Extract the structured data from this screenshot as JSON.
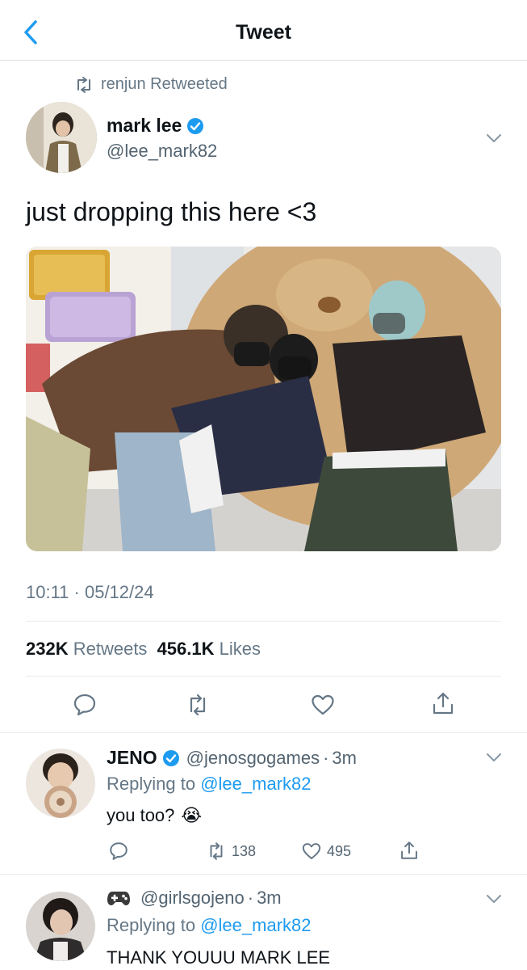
{
  "header": {
    "title": "Tweet"
  },
  "retweet_context": {
    "text": "renjun Retweeted"
  },
  "tweet": {
    "author_name": "mark lee",
    "author_handle": "@lee_mark82",
    "text": "just dropping this here <3",
    "timestamp": "10:11 · 05/12/24",
    "retweets_count": "232K",
    "retweets_label": "Retweets",
    "likes_count": "456.1K",
    "likes_label": "Likes"
  },
  "replies": [
    {
      "name": "JENO",
      "handle": "@jenosgogames",
      "time": "3m",
      "replying_prefix": "Replying to",
      "replying_to": "@lee_mark82",
      "text": "you too?",
      "emoji": "😭",
      "retweets": "138",
      "likes": "495"
    },
    {
      "name_icon": "game-controller-icon",
      "handle": "@girlsgojeno",
      "time": "3m",
      "replying_prefix": "Replying to",
      "replying_to": "@lee_mark82",
      "text": "THANK YOUUU MARK LEE"
    }
  ],
  "colors": {
    "accent": "#1d9bf0",
    "muted": "#657786",
    "text": "#0f1419"
  }
}
